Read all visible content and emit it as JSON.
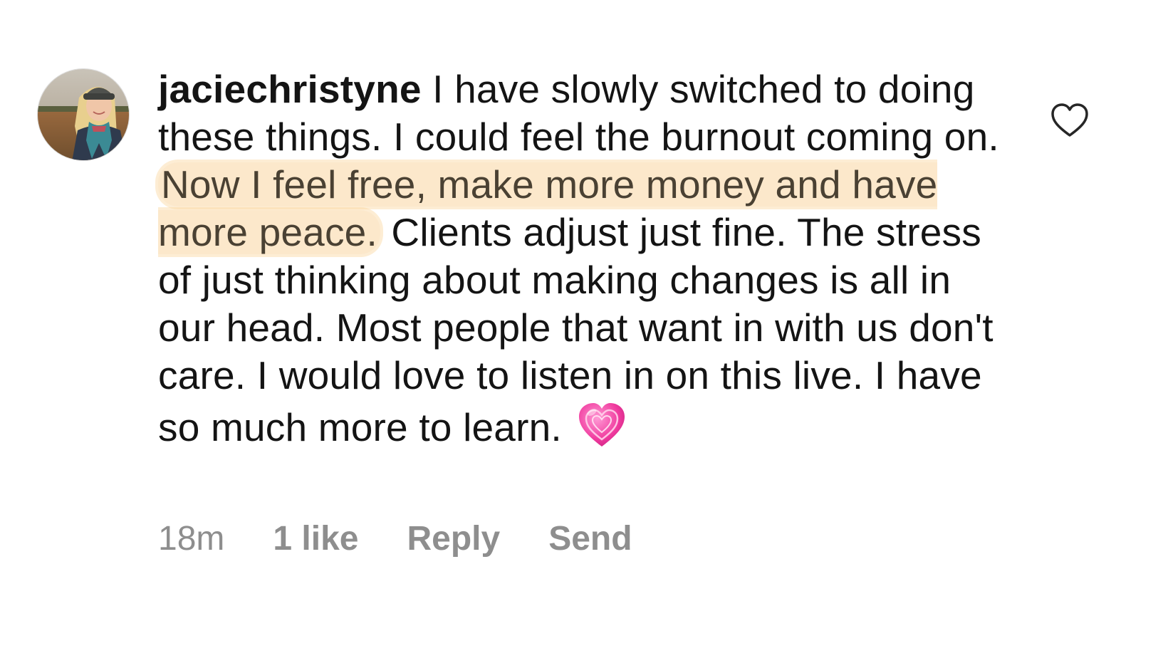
{
  "comment": {
    "username": "jaciechristyne",
    "text_before_highlight": " I have slowly switched to doing these things.  I could feel the burnout coming on. ",
    "text_highlight": "Now I feel free, make more money and have more peace.",
    "text_after_highlight": "  Clients adjust just fine.  The stress of just thinking about making changes is all in our head. Most people that want in with us don't care. I would love to listen in on this live. I have so much more to learn.",
    "emoji": "sparkling-heart-emoji",
    "highlight_color": "#FAD6A0"
  },
  "meta": {
    "time": "18m",
    "likes": "1 like",
    "reply_label": "Reply",
    "send_label": "Send"
  },
  "icons": {
    "like": "heart-outline-icon",
    "avatar": "profile-photo"
  }
}
